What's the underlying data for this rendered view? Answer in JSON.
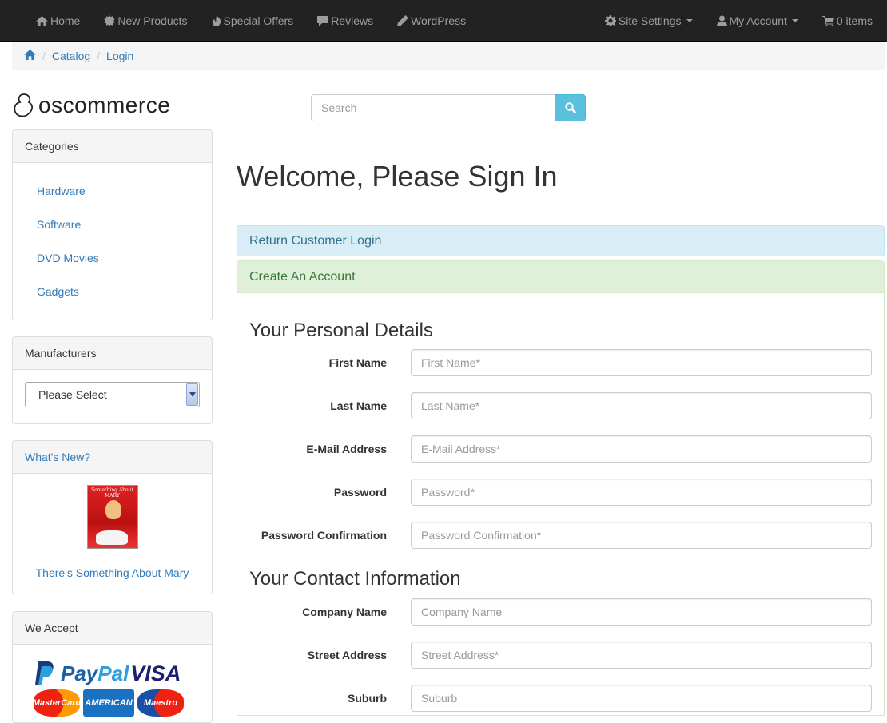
{
  "navbar": {
    "left": [
      {
        "label": "Home",
        "icon": "home-icon"
      },
      {
        "label": "New Products",
        "icon": "certificate-icon"
      },
      {
        "label": "Special Offers",
        "icon": "fire-icon"
      },
      {
        "label": "Reviews",
        "icon": "comment-icon"
      },
      {
        "label": "WordPress",
        "icon": "pencil-icon"
      }
    ],
    "right": [
      {
        "label": "Site Settings",
        "icon": "cog-icon"
      },
      {
        "label": "My Account",
        "icon": "user-icon"
      },
      {
        "label": "0 items",
        "icon": "shopping-cart-icon"
      }
    ]
  },
  "breadcrumb": {
    "items": [
      "Catalog",
      "Login"
    ]
  },
  "logo": {
    "text": "oscommerce"
  },
  "search": {
    "placeholder": "Search"
  },
  "sidebar": {
    "categories": {
      "title": "Categories",
      "items": [
        "Hardware",
        "Software",
        "DVD Movies",
        "Gadgets"
      ]
    },
    "manufacturers": {
      "title": "Manufacturers",
      "selected": "Please Select"
    },
    "whats_new": {
      "title": "What's New?",
      "product": "There's Something About Mary",
      "cover_text": "Something About MARY"
    },
    "we_accept": {
      "title": "We Accept",
      "paypal_pay": "Pay",
      "paypal_pal": "Pal",
      "visa": "VISA",
      "mastercard": "MasterCard",
      "amex": "AMERICAN",
      "maestro": "Maestro"
    }
  },
  "main": {
    "title": "Welcome, Please Sign In",
    "return_login": "Return Customer Login",
    "create_account": "Create An Account",
    "personal_title": "Your Personal Details",
    "contact_title": "Your Contact Information",
    "fields": {
      "first_name": {
        "label": "First Name",
        "placeholder": "First Name*"
      },
      "last_name": {
        "label": "Last Name",
        "placeholder": "Last Name*"
      },
      "email": {
        "label": "E-Mail Address",
        "placeholder": "E-Mail Address*"
      },
      "password": {
        "label": "Password",
        "placeholder": "Password*"
      },
      "password_confirm": {
        "label": "Password Confirmation",
        "placeholder": "Password Confirmation*"
      },
      "company": {
        "label": "Company Name",
        "placeholder": "Company Name"
      },
      "street": {
        "label": "Street Address",
        "placeholder": "Street Address*"
      },
      "suburb": {
        "label": "Suburb",
        "placeholder": "Suburb"
      }
    }
  },
  "colors": {
    "navbar_bg": "#222222",
    "link": "#337ab7",
    "info_bg": "#d9edf7",
    "success_bg": "#dff0d8",
    "search_btn": "#5bc0de"
  }
}
